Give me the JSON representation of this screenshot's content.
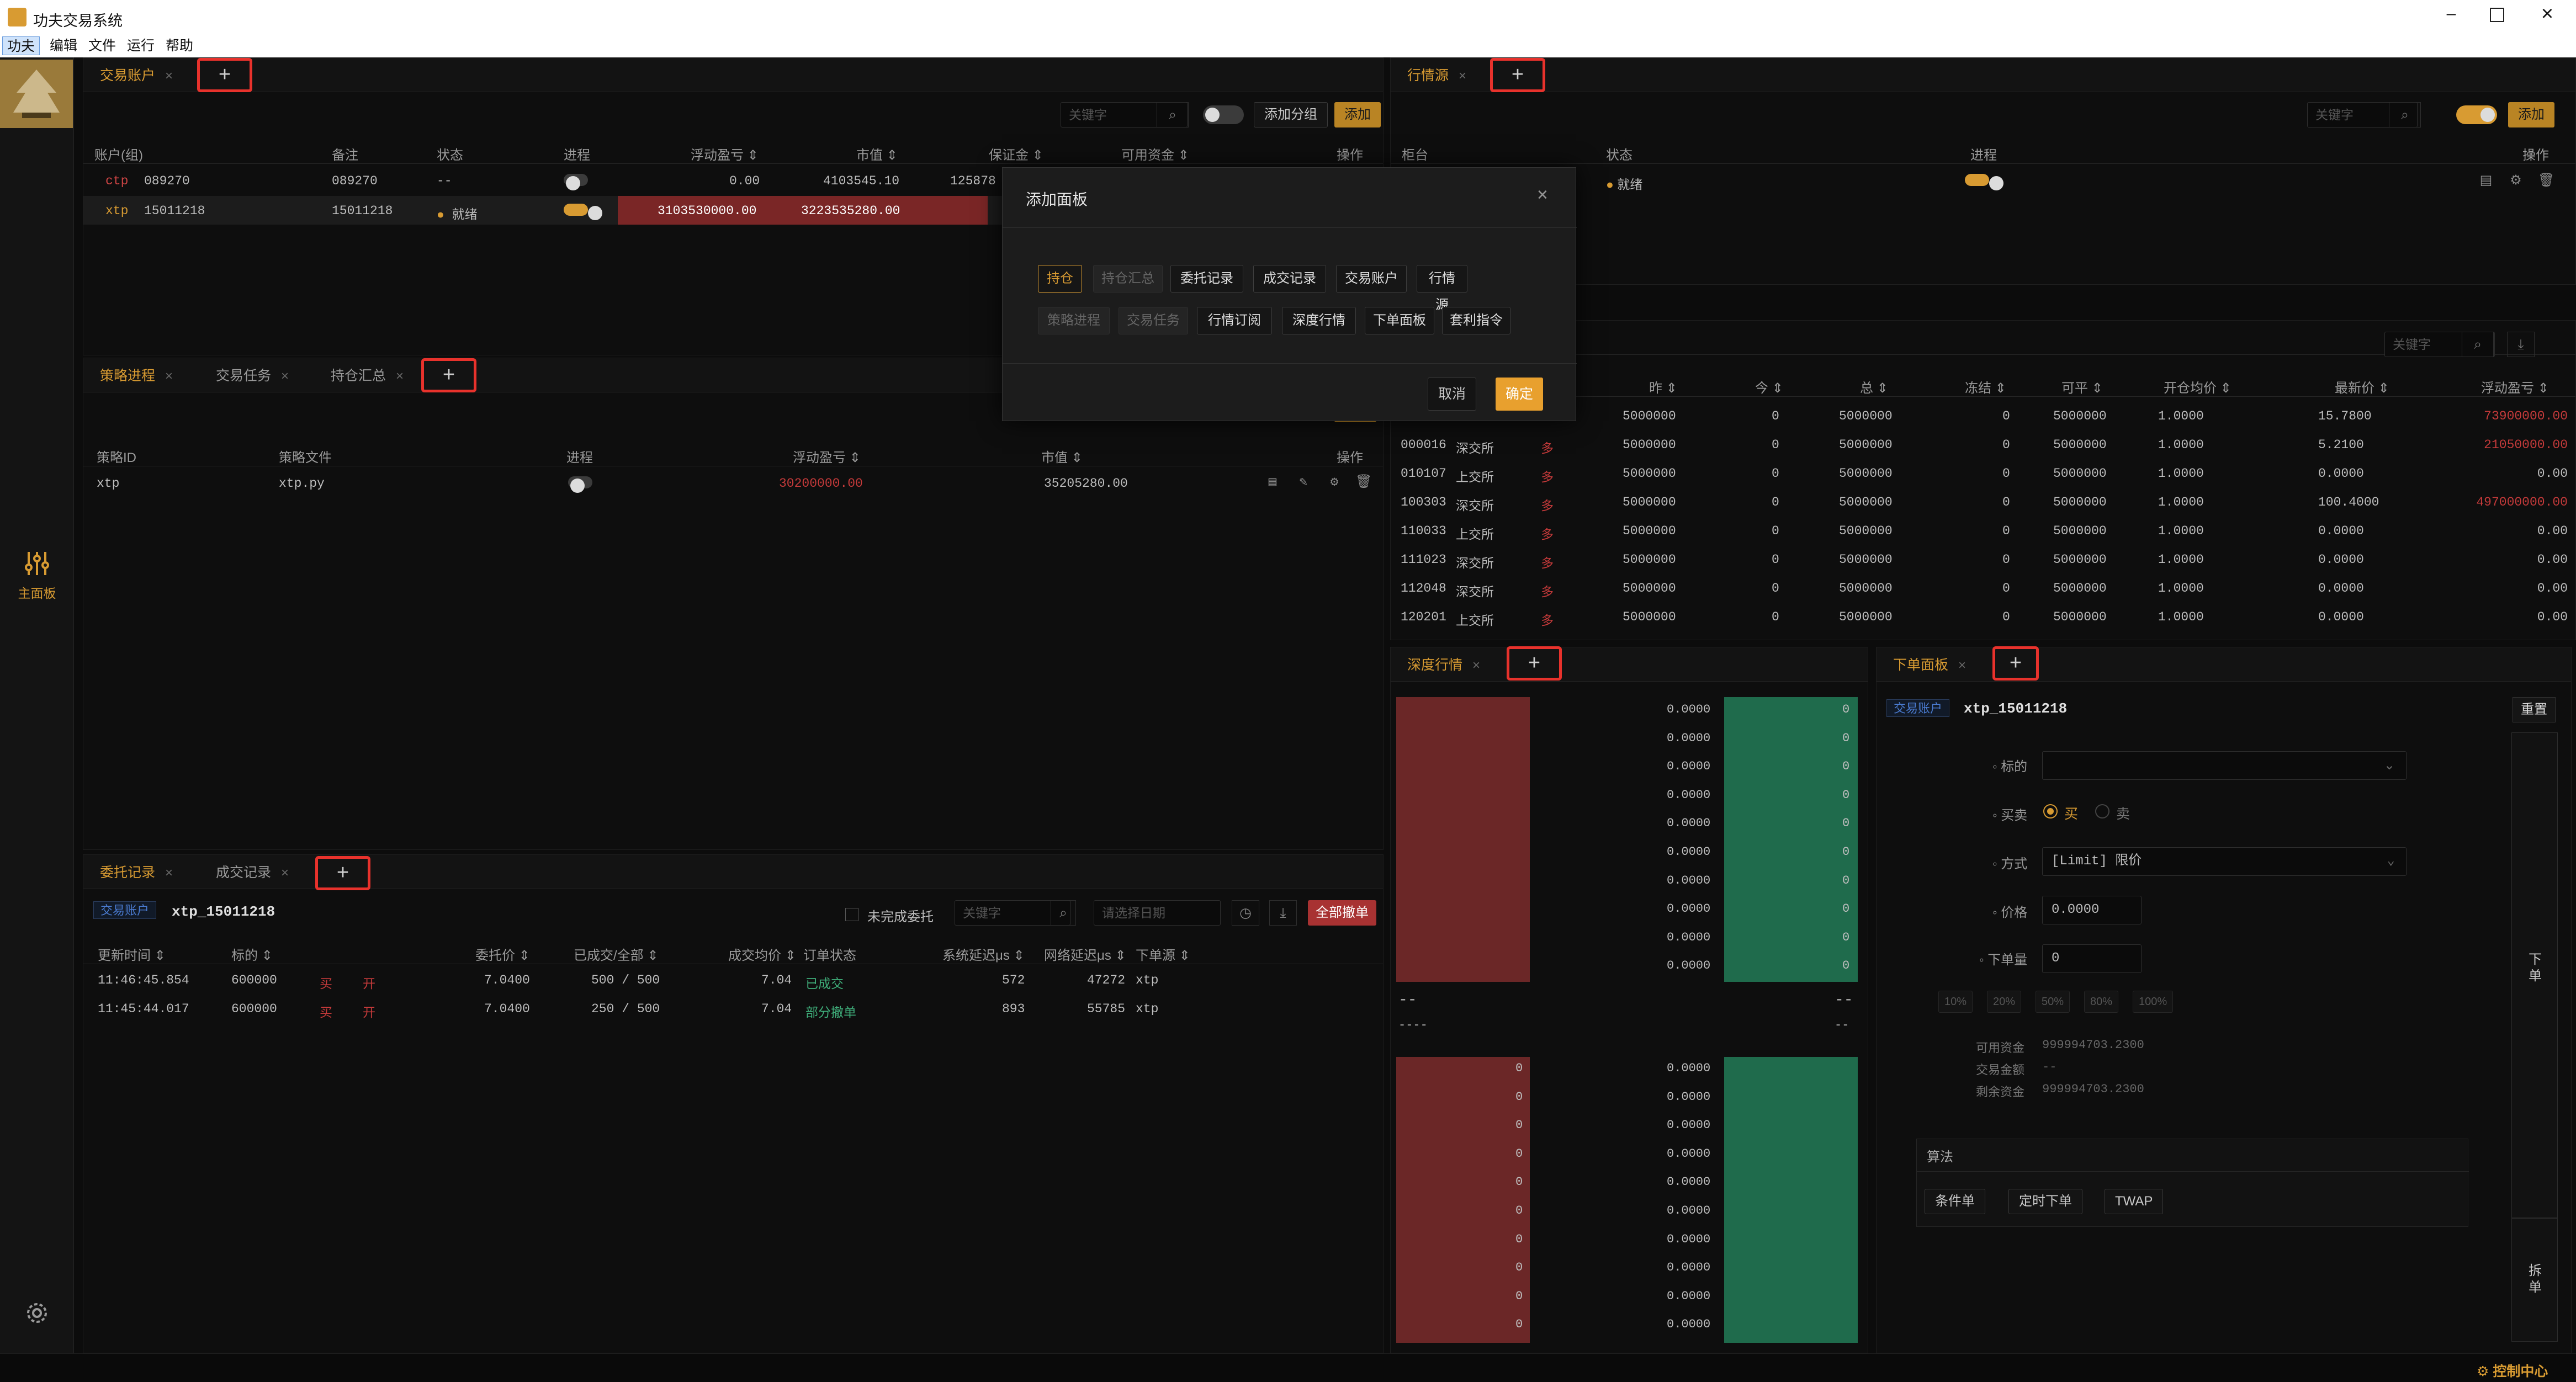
{
  "window": {
    "title": "功夫交易系统",
    "controls": [
      "minimize-icon",
      "maximize-icon",
      "close-icon"
    ]
  },
  "menu": [
    "功夫",
    "编辑",
    "文件",
    "运行",
    "帮助"
  ],
  "sidebar": {
    "main_panel_label": "主面板"
  },
  "statusbar": {
    "control_center": "控制中心"
  },
  "accounts_panel": {
    "tab": "交易账户",
    "search_placeholder": "关键字",
    "add_group": "添加分组",
    "add": "添加",
    "headers": [
      "账户(组)",
      "备注",
      "状态",
      "进程",
      "浮动盈亏 ⇕",
      "市值 ⇕",
      "保证金 ⇕",
      "可用资金 ⇕",
      "操作"
    ],
    "rows": [
      {
        "source": "ctp",
        "id": "089270",
        "note": "089270",
        "status": "--",
        "process": "off",
        "pnl": "0.00",
        "market_value": "4103545.10",
        "margin": "125878"
      },
      {
        "source": "xtp",
        "id": "15011218",
        "note": "15011218",
        "status": "就绪",
        "process": "on",
        "pnl": "3103530000.00",
        "market_value": "3223535280.00",
        "margin": ""
      }
    ]
  },
  "md_panel": {
    "tab": "行情源",
    "search_placeholder": "关键字",
    "add": "添加",
    "headers": [
      "柜台",
      "状态",
      "进程",
      "操作"
    ],
    "row": {
      "status": "就绪"
    }
  },
  "strategy_panel": {
    "tabs": [
      "策略进程",
      "交易任务",
      "持仓汇总"
    ],
    "headers": [
      "策略ID",
      "策略文件",
      "进程",
      "浮动盈亏 ⇕",
      "市值 ⇕",
      "操作"
    ],
    "rows": [
      {
        "id": "xtp",
        "file": "xtp.py",
        "pnl": "30200000.00",
        "market_value": "35205280.00"
      }
    ]
  },
  "position_panel": {
    "search_placeholder": "关键字",
    "headers": [
      "昨 ⇕",
      "今 ⇕",
      "总 ⇕",
      "冻结 ⇕",
      "可平 ⇕",
      "开仓均价 ⇕",
      "最新价 ⇕",
      "浮动盈亏 ⇕"
    ],
    "rows": [
      {
        "code": "000016",
        "exchange": "深交所",
        "dir": "多",
        "yd": "5000000",
        "td": "0",
        "total": "5000000",
        "frozen": "0",
        "closable": "5000000",
        "avg": "1.0000",
        "last": "5.2100",
        "pnl": "21050000.00"
      },
      {
        "code": "010107",
        "exchange": "上交所",
        "dir": "多",
        "yd": "5000000",
        "td": "0",
        "total": "5000000",
        "frozen": "0",
        "closable": "5000000",
        "avg": "1.0000",
        "last": "0.0000",
        "pnl": "0.00"
      },
      {
        "code": "100303",
        "exchange": "深交所",
        "dir": "多",
        "yd": "5000000",
        "td": "0",
        "total": "5000000",
        "frozen": "0",
        "closable": "5000000",
        "avg": "1.0000",
        "last": "100.4000",
        "pnl": "497000000.00"
      },
      {
        "code": "110033",
        "exchange": "上交所",
        "dir": "多",
        "yd": "5000000",
        "td": "0",
        "total": "5000000",
        "frozen": "0",
        "closable": "5000000",
        "avg": "1.0000",
        "last": "0.0000",
        "pnl": "0.00"
      },
      {
        "code": "111023",
        "exchange": "深交所",
        "dir": "多",
        "yd": "5000000",
        "td": "0",
        "total": "5000000",
        "frozen": "0",
        "closable": "5000000",
        "avg": "1.0000",
        "last": "0.0000",
        "pnl": "0.00"
      },
      {
        "code": "112048",
        "exchange": "深交所",
        "dir": "多",
        "yd": "5000000",
        "td": "0",
        "total": "5000000",
        "frozen": "0",
        "closable": "5000000",
        "avg": "1.0000",
        "last": "0.0000",
        "pnl": "0.00"
      },
      {
        "code": "120201",
        "exchange": "上交所",
        "dir": "多",
        "yd": "5000000",
        "td": "0",
        "total": "5000000",
        "frozen": "0",
        "closable": "5000000",
        "avg": "1.0000",
        "last": "0.0000",
        "pnl": "0.00"
      }
    ],
    "first_row": {
      "yd": "5000000",
      "td": "0",
      "total": "5000000",
      "frozen": "0",
      "closable": "5000000",
      "avg": "1.0000",
      "last": "15.7800",
      "pnl": "73900000.00"
    }
  },
  "orders_panel": {
    "tabs": [
      "委托记录",
      "成交记录"
    ],
    "account_tag": "交易账户",
    "account_id": "xtp_15011218",
    "unfinished": "未完成委托",
    "search_placeholder": "关键字",
    "date_placeholder": "请选择日期",
    "cancel_all": "全部撤单",
    "headers": [
      "更新时间 ⇕",
      "标的 ⇕",
      "委托价 ⇕",
      "已成交/全部 ⇕",
      "成交均价 ⇕",
      "订单状态",
      "系统延迟μs ⇕",
      "网络延迟μs ⇕",
      "下单源 ⇕"
    ],
    "rows": [
      {
        "time": "11:46:45.854",
        "symbol": "600000",
        "side": "买",
        "offset": "开",
        "price": "7.0400",
        "filled": "500 / 500",
        "avg": "7.04",
        "status": "已成交",
        "sys": "572",
        "net": "47272",
        "src": "xtp"
      },
      {
        "time": "11:45:44.017",
        "symbol": "600000",
        "side": "买",
        "offset": "开",
        "price": "7.0400",
        "filled": "250 / 500",
        "avg": "7.04",
        "status": "部分撤单",
        "sys": "893",
        "net": "55785",
        "src": "xtp"
      }
    ]
  },
  "depth_panel": {
    "tab": "深度行情",
    "ask_prices": [
      "0.0000",
      "0.0000",
      "0.0000",
      "0.0000",
      "0.0000",
      "0.0000",
      "0.0000",
      "0.0000",
      "0.0000",
      "0.0000"
    ],
    "ask_vols": [
      "0",
      "0",
      "0",
      "0",
      "0",
      "0",
      "0",
      "0",
      "0",
      "0"
    ],
    "mid_left": "--",
    "mid_right": "--",
    "mid_left2": "----",
    "mid_right2": "--",
    "bid_prices": [
      "0.0000",
      "0.0000",
      "0.0000",
      "0.0000",
      "0.0000",
      "0.0000",
      "0.0000",
      "0.0000",
      "0.0000",
      "0.0000"
    ],
    "bid_vols": [
      "0",
      "0",
      "0",
      "0",
      "0",
      "0",
      "0",
      "0",
      "0",
      "0"
    ],
    "ask_color": "#6b2727",
    "bid_color": "#1f6b4c"
  },
  "order_panel": {
    "tab": "下单面板",
    "account_tag": "交易账户",
    "account_id": "xtp_15011218",
    "reset": "重置",
    "instrument_label": "标的",
    "side_label": "买卖",
    "buy": "买",
    "sell": "卖",
    "type_label": "方式",
    "type_value": "[Limit] 限价",
    "price_label": "价格",
    "price_value": "0.0000",
    "volume_label": "下单量",
    "volume_value": "0",
    "pct_buttons": [
      "10%",
      "20%",
      "50%",
      "80%",
      "100%"
    ],
    "available_label": "可用资金",
    "available_value": "999994703.2300",
    "trade_amount_label": "交易金额",
    "trade_amount_value": "--",
    "remaining_label": "剩余资金",
    "remaining_value": "999994703.2300",
    "algo_title": "算法",
    "algo_buttons": [
      "条件单",
      "定时下单",
      "TWAP"
    ],
    "place_order": "下单",
    "split_order": "拆单"
  },
  "modal": {
    "title": "添加面板",
    "row1": [
      "持仓",
      "持仓汇总",
      "委托记录",
      "成交记录",
      "交易账户",
      "行情源"
    ],
    "row2": [
      "策略进程",
      "交易任务",
      "行情订阅",
      "深度行情",
      "下单面板",
      "套利指令"
    ],
    "cancel": "取消",
    "confirm": "确定"
  },
  "colors": {
    "accent": "#d89b32",
    "highlight_red": "#e8322c",
    "loss_bg": "#7a2626"
  }
}
